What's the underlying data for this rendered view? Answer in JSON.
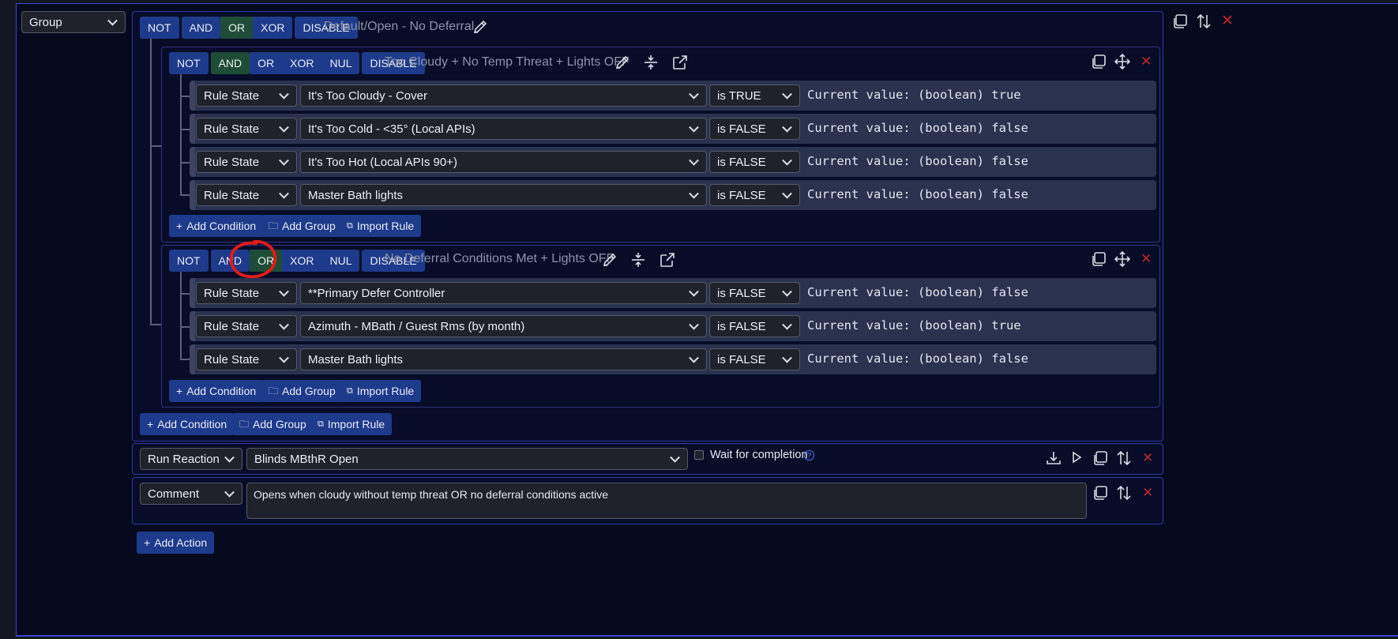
{
  "top_select": "Group",
  "ops": {
    "not": "NOT",
    "and": "AND",
    "or": "OR",
    "xor": "XOR",
    "nul": "NUL",
    "disable": "DISABLE"
  },
  "root_group": {
    "title": "Default/Open - No Deferral"
  },
  "group1": {
    "title": "Too Cloudy + No Temp Threat + Lights OFF",
    "conditions": [
      {
        "type": "Rule State",
        "rule": "It's Too Cloudy - Cover",
        "op": "is TRUE",
        "current": "Current value: (boolean) true"
      },
      {
        "type": "Rule State",
        "rule": "It's Too Cold - <35° (Local APIs)",
        "op": "is FALSE",
        "current": "Current value: (boolean) false"
      },
      {
        "type": "Rule State",
        "rule": "It's Too Hot (Local APIs 90+)",
        "op": "is FALSE",
        "current": "Current value: (boolean) false"
      },
      {
        "type": "Rule State",
        "rule": "Master Bath lights",
        "op": "is FALSE",
        "current": "Current value: (boolean) false"
      }
    ]
  },
  "group2": {
    "title": "No Deferral Conditions Met + Lights OFF",
    "conditions": [
      {
        "type": "Rule State",
        "rule": "**Primary Defer Controller",
        "op": "is FALSE",
        "current": "Current value: (boolean) false"
      },
      {
        "type": "Rule State",
        "rule": "Azimuth - MBath / Guest Rms (by month)",
        "op": "is FALSE",
        "current": "Current value: (boolean) true"
      },
      {
        "type": "Rule State",
        "rule": "Master Bath lights",
        "op": "is FALSE",
        "current": "Current value: (boolean) false"
      }
    ]
  },
  "buttons": {
    "add_condition": "Add Condition",
    "add_group": "Add Group",
    "import_rule": "Import Rule",
    "add_action": "Add Action"
  },
  "reaction": {
    "type": "Run Reaction",
    "target": "Blinds MBthR Open",
    "wait_label": "Wait for completion"
  },
  "comment": {
    "type": "Comment",
    "text": "Opens when cloudy without temp threat OR no deferral conditions active"
  },
  "colors": {
    "accent": "#1e3a8a",
    "active_op": "#1f4c36",
    "border": "#3a47c9",
    "delete": "#c0272d",
    "annotation": "#e01b1b"
  },
  "annotation": "red-circle-around-or-button"
}
